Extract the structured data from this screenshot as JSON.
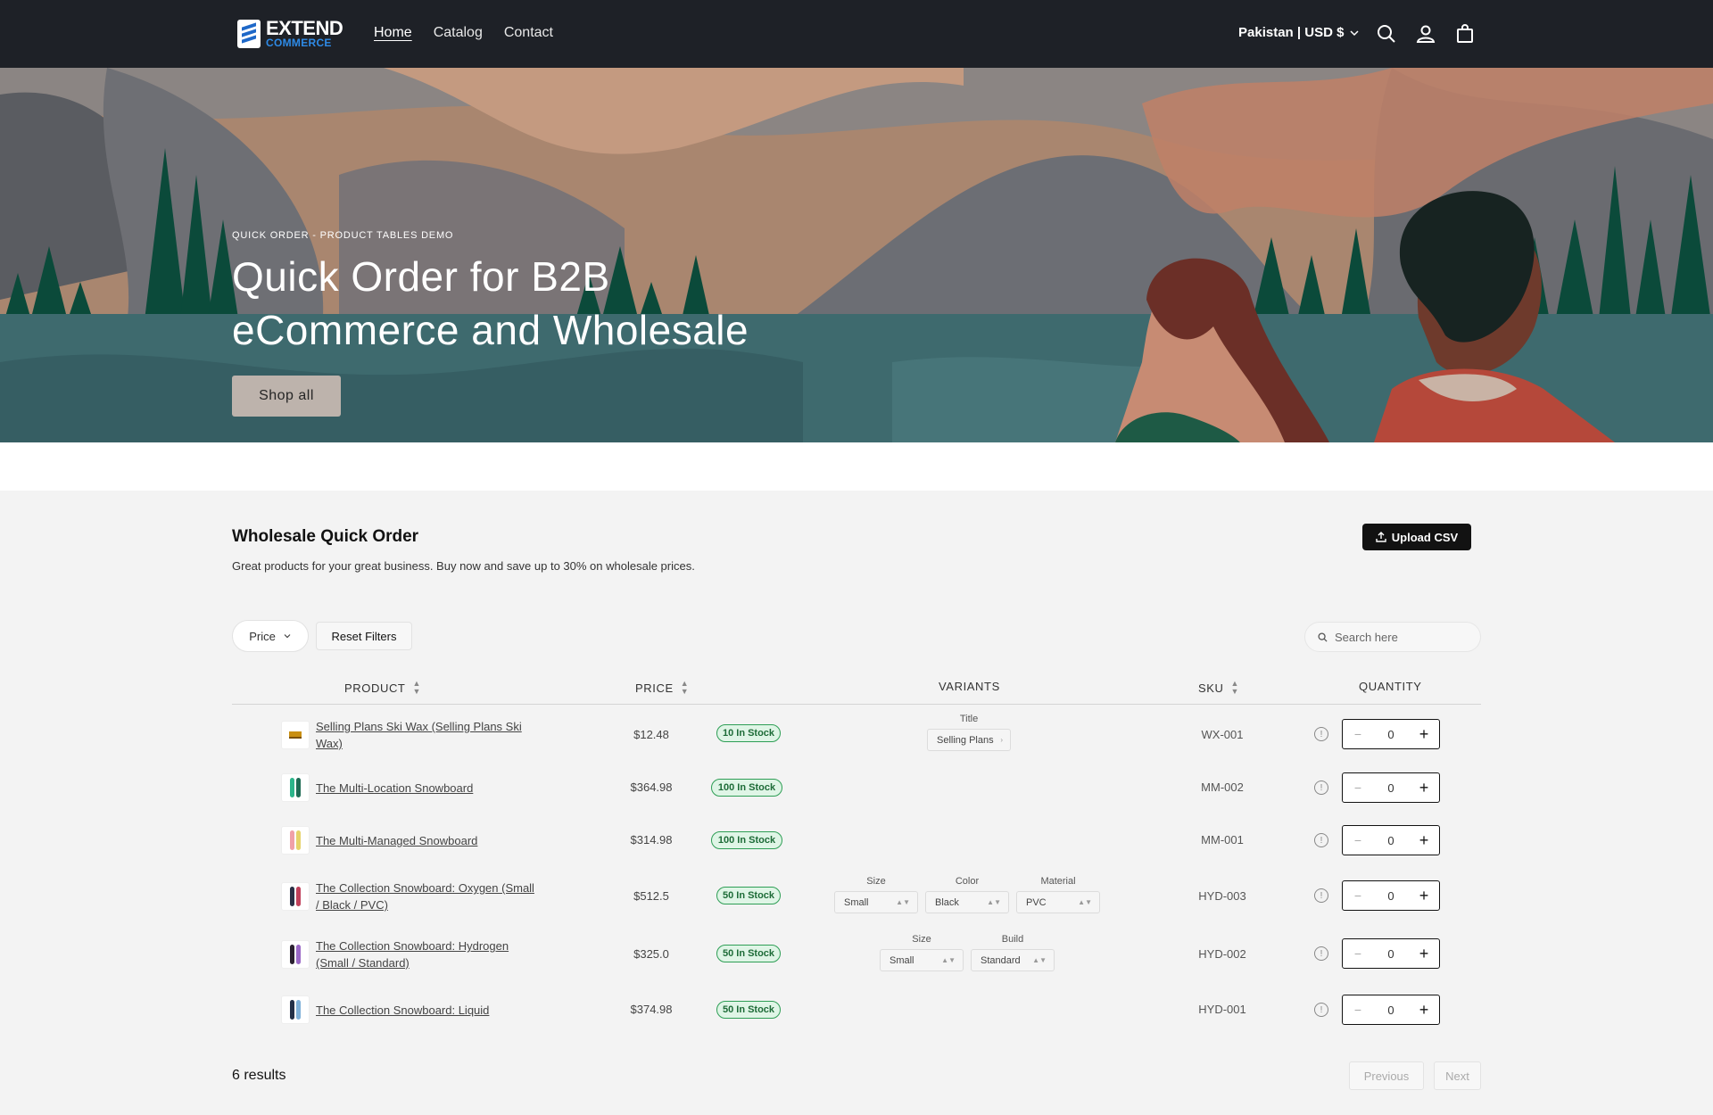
{
  "header": {
    "logo_line1": "EXTEND",
    "logo_line2": "COMMERCE",
    "nav": [
      "Home",
      "Catalog",
      "Contact"
    ],
    "region": "Pakistan | USD $"
  },
  "hero": {
    "kicker": "QUICK ORDER - PRODUCT TABLES DEMO",
    "title_line1": "Quick Order for B2B",
    "title_line2": "eCommerce and Wholesale",
    "cta": "Shop all"
  },
  "section": {
    "title": "Wholesale Quick Order",
    "subtitle": "Great products for your great business. Buy now and save up to 30% on wholesale prices.",
    "upload_label": "Upload CSV"
  },
  "filters": {
    "price_label": "Price",
    "reset_label": "Reset Filters",
    "search_placeholder": "Search here"
  },
  "table": {
    "columns": [
      "PRODUCT",
      "PRICE",
      "VARIANTS",
      "SKU",
      "QUANTITY"
    ],
    "rows": [
      {
        "name": "Selling Plans Ski Wax (Selling Plans Ski Wax)",
        "price": "$12.48",
        "stock": "10 In Stock",
        "variants": [
          {
            "label": "Title",
            "value": "Selling Plans"
          }
        ],
        "sku": "WX-001",
        "qty": "0"
      },
      {
        "name": "The Multi-Location Snowboard",
        "price": "$364.98",
        "stock": "100 In Stock",
        "variants": [],
        "sku": "MM-002",
        "qty": "0"
      },
      {
        "name": "The Multi-Managed Snowboard",
        "price": "$314.98",
        "stock": "100 In Stock",
        "variants": [],
        "sku": "MM-001",
        "qty": "0"
      },
      {
        "name": "The Collection Snowboard: Oxygen (Small / Black / PVC)",
        "price": "$512.5",
        "stock": "50 In Stock",
        "variants": [
          {
            "label": "Size",
            "value": "Small"
          },
          {
            "label": "Color",
            "value": "Black"
          },
          {
            "label": "Material",
            "value": "PVC"
          }
        ],
        "sku": "HYD-003",
        "qty": "0"
      },
      {
        "name": "The Collection Snowboard: Hydrogen (Small / Standard)",
        "price": "$325.0",
        "stock": "50 In Stock",
        "variants": [
          {
            "label": "Size",
            "value": "Small"
          },
          {
            "label": "Build",
            "value": "Standard"
          }
        ],
        "sku": "HYD-002",
        "qty": "0"
      },
      {
        "name": "The Collection Snowboard: Liquid",
        "price": "$374.98",
        "stock": "50 In Stock",
        "variants": [],
        "sku": "HYD-001",
        "qty": "0"
      }
    ]
  },
  "footer": {
    "results": "6 results",
    "previous": "Previous",
    "next": "Next"
  },
  "colors": {
    "header_bg": "#1e2127",
    "accent_blue": "#2e8ae6",
    "stock_green": "#2e9e55",
    "hero_button": "#bdb3ac"
  }
}
